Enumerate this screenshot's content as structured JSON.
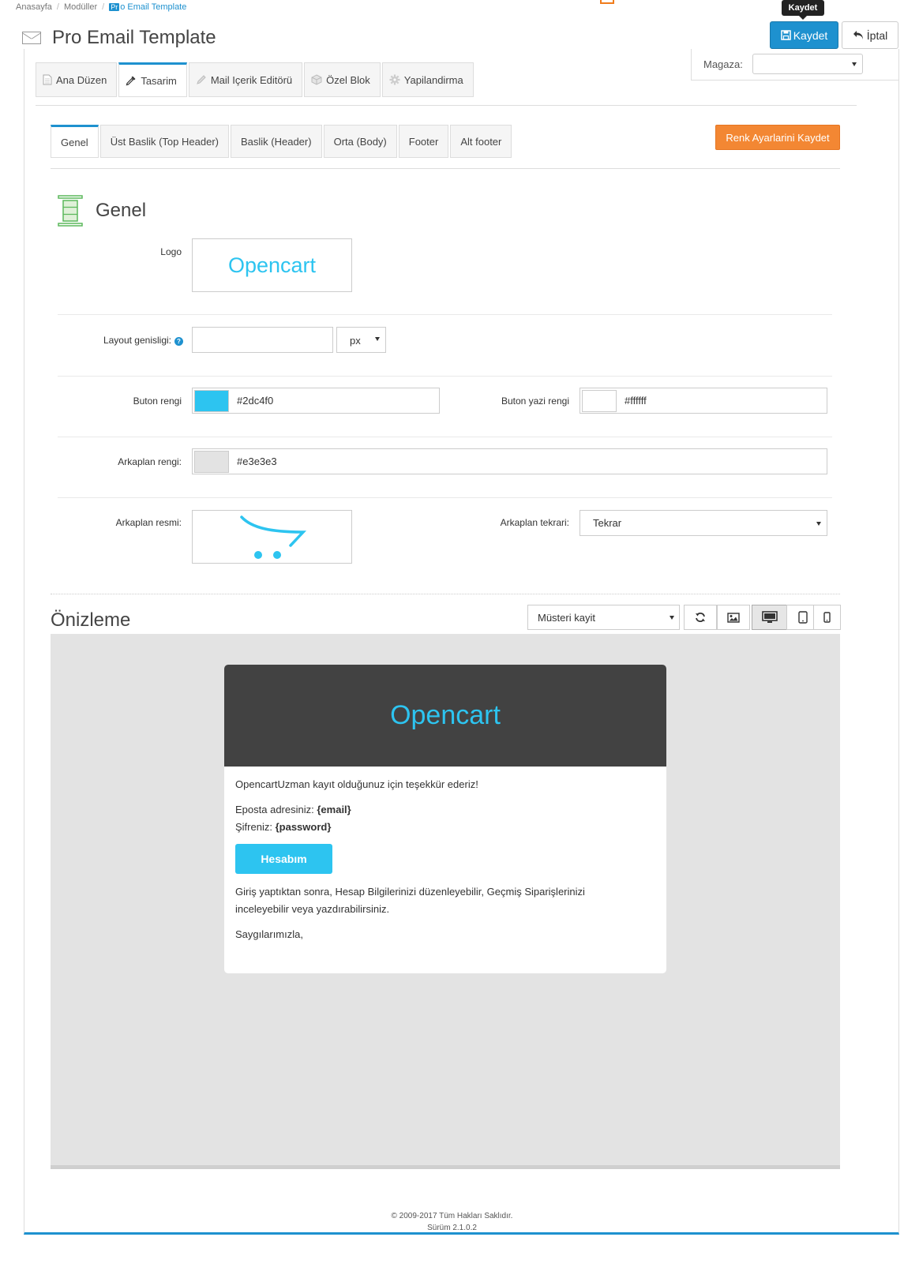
{
  "breadcrumb": {
    "home": "Anasayfa",
    "modules": "Modüller",
    "badge": "Pr",
    "current": "o Email Template"
  },
  "page": {
    "title": "Pro Email Template"
  },
  "actions": {
    "tooltip": "Kaydet",
    "save": "Kaydet",
    "cancel": "İptal"
  },
  "store": {
    "label": "Magaza:",
    "value": ""
  },
  "main_tabs": [
    "Ana Düzen",
    "Tasarim",
    "Mail Içerik Editörü",
    "Özel Blok",
    "Yapilandirma"
  ],
  "sub_tabs": [
    "Genel",
    "Üst Baslik (Top Header)",
    "Baslik (Header)",
    "Orta (Body)",
    "Footer",
    "Alt footer"
  ],
  "save_colors_button": "Renk Ayarlarini Kaydet",
  "section": {
    "title": "Genel"
  },
  "form": {
    "logo_label": "Logo",
    "logo_text": "Opencart",
    "layout_label": "Layout genisligi:",
    "layout_value": "",
    "layout_unit": "px",
    "button_color_label": "Buton rengi",
    "button_color": "#2dc4f0",
    "button_text_color_label": "Buton yazi rengi",
    "button_text_color": "#ffffff",
    "bg_color_label": "Arkaplan rengi:",
    "bg_color": "#e3e3e3",
    "bg_image_label": "Arkaplan resmi:",
    "bg_repeat_label": "Arkaplan tekrari:",
    "bg_repeat_value": "Tekrar"
  },
  "preview": {
    "title": "Önizleme",
    "template_select": "Müsteri kayit",
    "mail": {
      "header_logo": "Opencart",
      "thanks": "OpencartUzman kayıt olduğunuz için teşekkür ederiz!",
      "email_label": "Eposta adresiniz:",
      "email_value": "{email}",
      "password_label": "Şifreniz:",
      "password_value": "{password}",
      "button": "Hesabım",
      "info_line1": "Giriş yaptıktan sonra, Hesap Bilgilerinizi düzenleyebilir, Geçmiş Siparişlerinizi",
      "info_line2": "inceleyebilir veya yazdırabilirsiniz.",
      "regards": "Saygılarımızla,"
    }
  },
  "footer": {
    "copyright": "© 2009-2017 Tüm Hakları Saklıdır.",
    "version": "Sürüm 2.1.0.2"
  },
  "colors": {
    "accent": "#1e91cf",
    "orange": "#f38733",
    "opencart_blue": "#2dc4f0",
    "mail_header": "#424242"
  },
  "icons": [
    "envelope-icon",
    "save-icon",
    "undo-icon",
    "document-icon",
    "eyedropper-icon",
    "pencil-icon",
    "cube-icon",
    "gear-icon",
    "columns-icon",
    "help-icon",
    "cart-image",
    "refresh-icon",
    "image-icon",
    "desktop-icon",
    "tablet-icon",
    "mobile-icon"
  ]
}
